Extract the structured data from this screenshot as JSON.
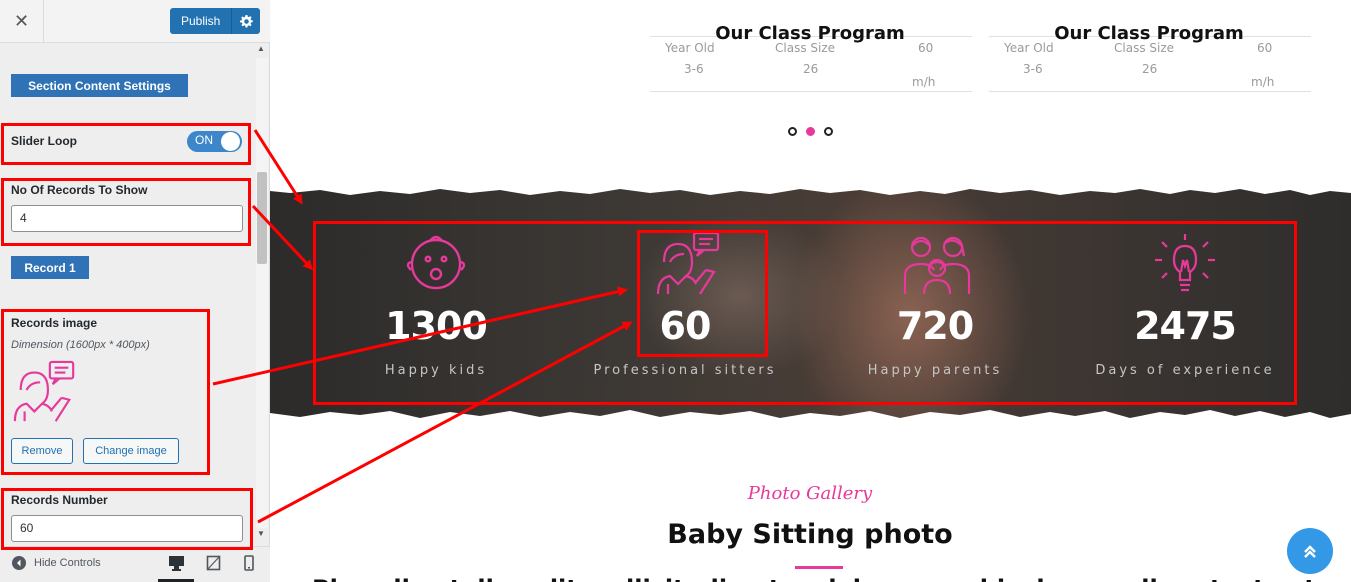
{
  "sidebar": {
    "close_glyph": "✕",
    "publish_label": "Publish",
    "section_button": "Section Content Settings",
    "slider_loop_label": "Slider Loop",
    "slider_loop_state": "ON",
    "records_to_show_label": "No Of Records To Show",
    "records_to_show_value": "4",
    "record_button": "Record 1",
    "records_image_label": "Records image",
    "records_image_dimension": "Dimension (1600px * 400px)",
    "remove_label": "Remove",
    "change_image_label": "Change image",
    "records_number_label": "Records Number",
    "records_number_value": "60",
    "hide_controls_label": "Hide Controls"
  },
  "class_tables": [
    {
      "title": "Our Class Program",
      "col1_head": "Year Old",
      "col2_head": "Class Size",
      "col3_head": "60",
      "col1_val": "3-6",
      "col2_val": "26",
      "col3_val": "m/h"
    },
    {
      "title": "Our Class Program",
      "col1_head": "Year Old",
      "col2_head": "Class Size",
      "col3_head": "60",
      "col1_val": "3-6",
      "col2_val": "26",
      "col3_val": "m/h"
    }
  ],
  "slider_dots": {
    "count": 3,
    "active_index": 1
  },
  "stats": [
    {
      "icon": "baby-face-icon",
      "number": "1300",
      "caption": "Happy kids"
    },
    {
      "icon": "sitter-chat-icon",
      "number": "60",
      "caption": "Professional sitters"
    },
    {
      "icon": "family-icon",
      "number": "720",
      "caption": "Happy parents"
    },
    {
      "icon": "lightbulb-icon",
      "number": "2475",
      "caption": "Days of experience"
    }
  ],
  "gallery": {
    "subtitle": "Photo Gallery",
    "title": "Baby Sitting photo",
    "cut_text": "Phasellus tellus elit, sollicitudin et sodales ac, vehicula ac gallery text cut"
  },
  "colors": {
    "accent_pink": "#e6399b",
    "customizer_blue": "#2271b1",
    "annotation_red": "#ff0000",
    "scroll_top_blue": "#3399e6"
  }
}
